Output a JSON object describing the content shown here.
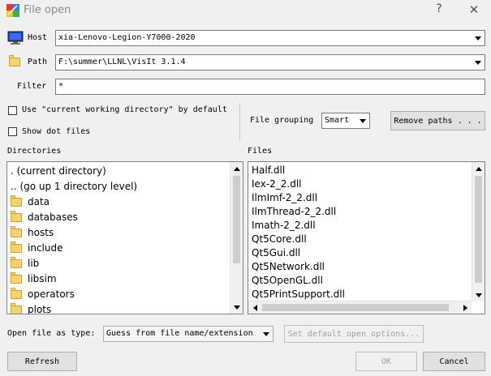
{
  "window": {
    "title": "File open",
    "help": "?",
    "close": "✕"
  },
  "host": {
    "label": "Host",
    "value": "xia-Lenovo-Legion-Y7000-2020"
  },
  "path": {
    "label": "Path",
    "value": "F:\\summer\\LLNL\\VisIt 3.1.4"
  },
  "filter": {
    "label": "Filter",
    "value": "*"
  },
  "options": {
    "use_cwd_label": "Use \"current working directory\" by default",
    "use_cwd_checked": false,
    "show_dot_label": "Show dot files",
    "show_dot_checked": false
  },
  "grouping": {
    "label": "File grouping",
    "value": "Smart"
  },
  "remove_paths": {
    "label": "Remove paths . . ."
  },
  "directories": {
    "label": "Directories",
    "items": [
      {
        "text": ". (current directory)",
        "icon": ""
      },
      {
        "text": ".. (go up 1 directory level)",
        "icon": ""
      },
      {
        "text": "data",
        "icon": "folder-icon"
      },
      {
        "text": "databases",
        "icon": "folder-icon"
      },
      {
        "text": "hosts",
        "icon": "folder-icon"
      },
      {
        "text": "include",
        "icon": "folder-icon"
      },
      {
        "text": "lib",
        "icon": "folder-icon"
      },
      {
        "text": "libsim",
        "icon": "folder-icon"
      },
      {
        "text": "operators",
        "icon": "folder-icon"
      },
      {
        "text": "plots",
        "icon": "folder-icon"
      }
    ]
  },
  "files": {
    "label": "Files",
    "items": [
      "Half.dll",
      "Iex-2_2.dll",
      "IlmImf-2_2.dll",
      "IlmThread-2_2.dll",
      "Imath-2_2.dll",
      "Qt5Core.dll",
      "Qt5Gui.dll",
      "Qt5Network.dll",
      "Qt5OpenGL.dll",
      "Qt5PrintSupport.dll"
    ]
  },
  "open_as": {
    "label": "Open file as type:",
    "value": "Guess from file name/extension"
  },
  "set_default": {
    "label": "Set default open options..."
  },
  "buttons": {
    "refresh": "Refresh",
    "ok": "OK",
    "cancel": "Cancel"
  }
}
